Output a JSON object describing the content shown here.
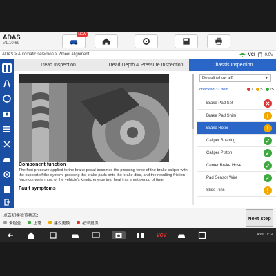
{
  "app": {
    "title": "ADAS",
    "version": "V1.10.69"
  },
  "toolbar": {
    "new_badge": "NEW",
    "buttons": [
      "vehicle-button",
      "home-button",
      "settings-button",
      "save-button",
      "print-button"
    ]
  },
  "breadcrumb": "ADAS > Automatic selection > Wheel alignment",
  "status": {
    "vci_label": "VCI",
    "voltage": "0.0V"
  },
  "tabs": [
    {
      "label": "Tread Inspection"
    },
    {
      "label": "Tread Depth & Pressure Inspection"
    },
    {
      "label": "Chassis Inspection",
      "active": true
    }
  ],
  "content": {
    "component_function_title": "Component function",
    "component_function_text": "The foot pressure applied to the brake pedal becomes the pressing force of the brake caliper with the support of the system, pressing the brake pads onto the brake disc, and the resulting friction force converts most of the vehicle's kinetic energy into heat in a short period of time.",
    "fault_symptoms_title": "Fault symptoms"
  },
  "right_panel": {
    "dropdown_value": "Default (show all)",
    "checked_label": "checked 31 item",
    "counts": {
      "red": "1",
      "yellow": "5",
      "green": "25"
    },
    "items": [
      {
        "label": "Brake Pad Set",
        "status": "tool"
      },
      {
        "label": "Brake Pad Shim",
        "status": "warn"
      },
      {
        "label": "Brake Rotor",
        "status": "warn",
        "selected": true
      },
      {
        "label": "Caliper Bushing",
        "status": "ok"
      },
      {
        "label": "Caliper Piston",
        "status": "ok"
      },
      {
        "label": "Center Brake Hose",
        "status": "ok"
      },
      {
        "label": "Pad Sensor Wire",
        "status": "ok"
      },
      {
        "label": "Slide Pins",
        "status": "warn"
      }
    ]
  },
  "footer": {
    "hint": "点击切换检查状态：",
    "legend": [
      {
        "label": "未检查",
        "color": "#9a9a9a"
      },
      {
        "label": "正常",
        "color": "#3da83d"
      },
      {
        "label": "建议更换",
        "color": "#f0a800"
      },
      {
        "label": "必须更换",
        "color": "#d33"
      }
    ],
    "next_label": "Next step"
  },
  "system": {
    "status_text": "43% 11:14",
    "vcv_label": "VCV"
  },
  "colors": {
    "primary": "#2a66c7",
    "sidebar": "#1b4fa3",
    "ok": "#3da83d",
    "warn": "#f0a800",
    "error": "#d33"
  }
}
